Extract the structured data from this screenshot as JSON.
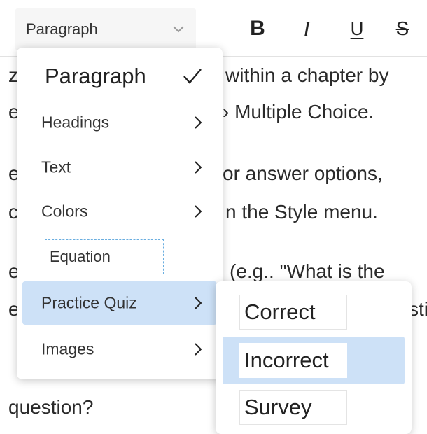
{
  "toolbar": {
    "style_select_value": "Paragraph",
    "bold_label": "B",
    "italic_label": "I",
    "underline_label": "U",
    "strikethrough_label": "S"
  },
  "document": {
    "lines": [
      "z",
      "within a chapter by",
      "e",
      "› Multiple Choice.",
      "e",
      "or answer options,",
      "c",
      "n the Style menu.",
      "e",
      "(e.g.. \"What is the",
      "e",
      "sti",
      "question?"
    ]
  },
  "menu": {
    "items": [
      {
        "label": "Paragraph",
        "icon": "check-icon",
        "selected": true
      },
      {
        "label": "Headings",
        "icon": "chevron-right-icon"
      },
      {
        "label": "Text",
        "icon": "chevron-right-icon"
      },
      {
        "label": "Colors",
        "icon": "chevron-right-icon"
      },
      {
        "label": "Equation"
      },
      {
        "label": "Practice Quiz",
        "icon": "chevron-right-icon",
        "highlighted": true
      },
      {
        "label": "Images",
        "icon": "chevron-right-icon"
      }
    ]
  },
  "submenu": {
    "items": [
      {
        "label": "Correct"
      },
      {
        "label": "Incorrect",
        "highlighted": true
      },
      {
        "label": "Survey"
      }
    ]
  },
  "colors": {
    "highlight": "#cde1f7",
    "select_background": "#f6f6f6",
    "equation_border": "#6aaee0"
  }
}
